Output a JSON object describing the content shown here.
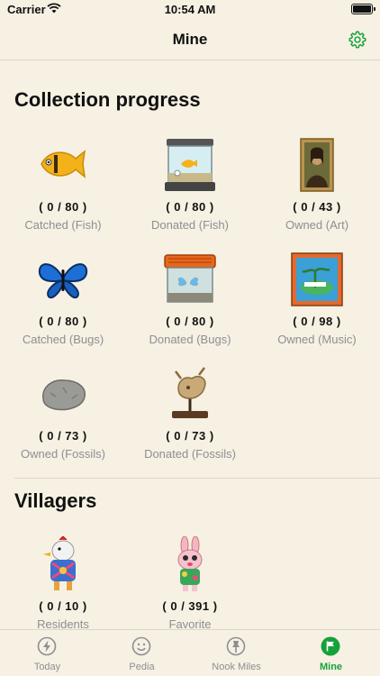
{
  "status_bar": {
    "carrier": "Carrier",
    "time": "10:54 AM"
  },
  "nav": {
    "title": "Mine",
    "settings_icon": "gear-icon"
  },
  "collection": {
    "title": "Collection progress",
    "items": [
      {
        "count": "( 0 / 80 )",
        "label": "Catched (Fish)",
        "icon": "fish-icon"
      },
      {
        "count": "( 0 / 80 )",
        "label": "Donated (Fish)",
        "icon": "aquarium-icon"
      },
      {
        "count": "( 0 / 43 )",
        "label": "Owned (Art)",
        "icon": "painting-icon"
      },
      {
        "count": "( 0 / 80 )",
        "label": "Catched (Bugs)",
        "icon": "butterfly-icon"
      },
      {
        "count": "( 0 / 80 )",
        "label": "Donated (Bugs)",
        "icon": "bug-cage-icon"
      },
      {
        "count": "( 0 / 98 )",
        "label": "Owned (Music)",
        "icon": "album-cover-icon"
      },
      {
        "count": "( 0 / 73 )",
        "label": "Owned (Fossils)",
        "icon": "fossil-rock-icon"
      },
      {
        "count": "( 0 / 73 )",
        "label": "Donated (Fossils)",
        "icon": "dinosaur-skeleton-icon"
      }
    ]
  },
  "villagers": {
    "title": "Villagers",
    "items": [
      {
        "count": "( 0 / 10 )",
        "label": "Residents",
        "icon": "resident-villager-icon"
      },
      {
        "count": "( 0 / 391 )",
        "label": "Favorite",
        "icon": "favorite-villager-icon"
      }
    ]
  },
  "tabbar": {
    "tabs": [
      {
        "label": "Today",
        "icon": "lightning-icon"
      },
      {
        "label": "Pedia",
        "icon": "smiley-icon"
      },
      {
        "label": "Nook Miles",
        "icon": "pin-icon"
      },
      {
        "label": "Mine",
        "icon": "flag-icon",
        "active": true
      }
    ]
  },
  "colors": {
    "background": "#f6f1e3",
    "accent": "#16a23a",
    "secondary_text": "#8e8e93"
  }
}
